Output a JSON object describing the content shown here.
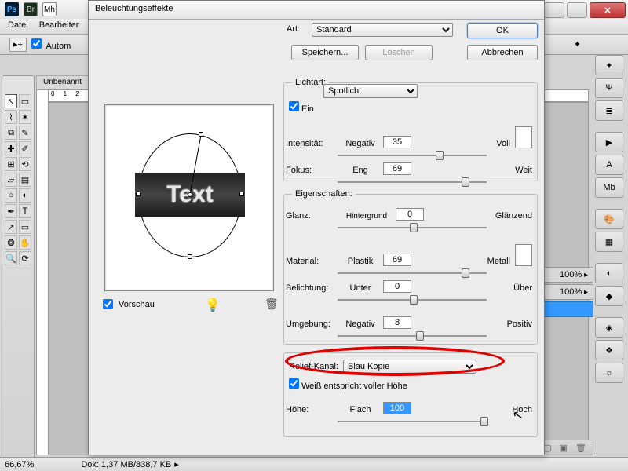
{
  "window": {
    "close_glyph": "✕"
  },
  "menubar": {
    "datei": "Datei",
    "bearbeiten": "Bearbeiter"
  },
  "optbar": {
    "autom": "Autom"
  },
  "doc_tab": "Unbenannt",
  "statusbar": {
    "zoom": "66,67%",
    "doc": "Dok: 1,37 MB/838,7 KB"
  },
  "panels": {
    "pct1": "100%",
    "pct2": "100%"
  },
  "dialog": {
    "title": "Beleuchtungseffekte",
    "ok": "OK",
    "cancel": "Abbrechen",
    "save": "Speichern...",
    "delete": "Löschen",
    "art_label": "Art:",
    "art_value": "Standard",
    "preview_label": "Vorschau",
    "preview_text": "Text",
    "licht": {
      "legend": "Lichtart:",
      "type": "Spotlicht",
      "ein": "Ein",
      "intensitat": "Intensität:",
      "neg": "Negativ",
      "voll": "Voll",
      "int_val": "35",
      "fokus": "Fokus:",
      "eng": "Eng",
      "weit": "Weit",
      "fokus_val": "69"
    },
    "eig": {
      "legend": "Eigenschaften:",
      "glanz": "Glanz:",
      "hintergrund": "Hintergrund",
      "glanzend": "Glänzend",
      "glanz_val": "0",
      "material": "Material:",
      "plastik": "Plastik",
      "metall": "Metall",
      "mat_val": "69",
      "belichtung": "Belichtung:",
      "unter": "Unter",
      "uber": "Über",
      "bel_val": "0",
      "umgebung": "Umgebung:",
      "negativ": "Negativ",
      "positiv": "Positiv",
      "umg_val": "8"
    },
    "relief": {
      "label": "Relief-Kanal:",
      "value": "Blau Kopie",
      "weiss": "Weiß entspricht voller Höhe",
      "hohe": "Höhe:",
      "flach": "Flach",
      "hoch": "Hoch",
      "hohe_val": "100"
    }
  }
}
